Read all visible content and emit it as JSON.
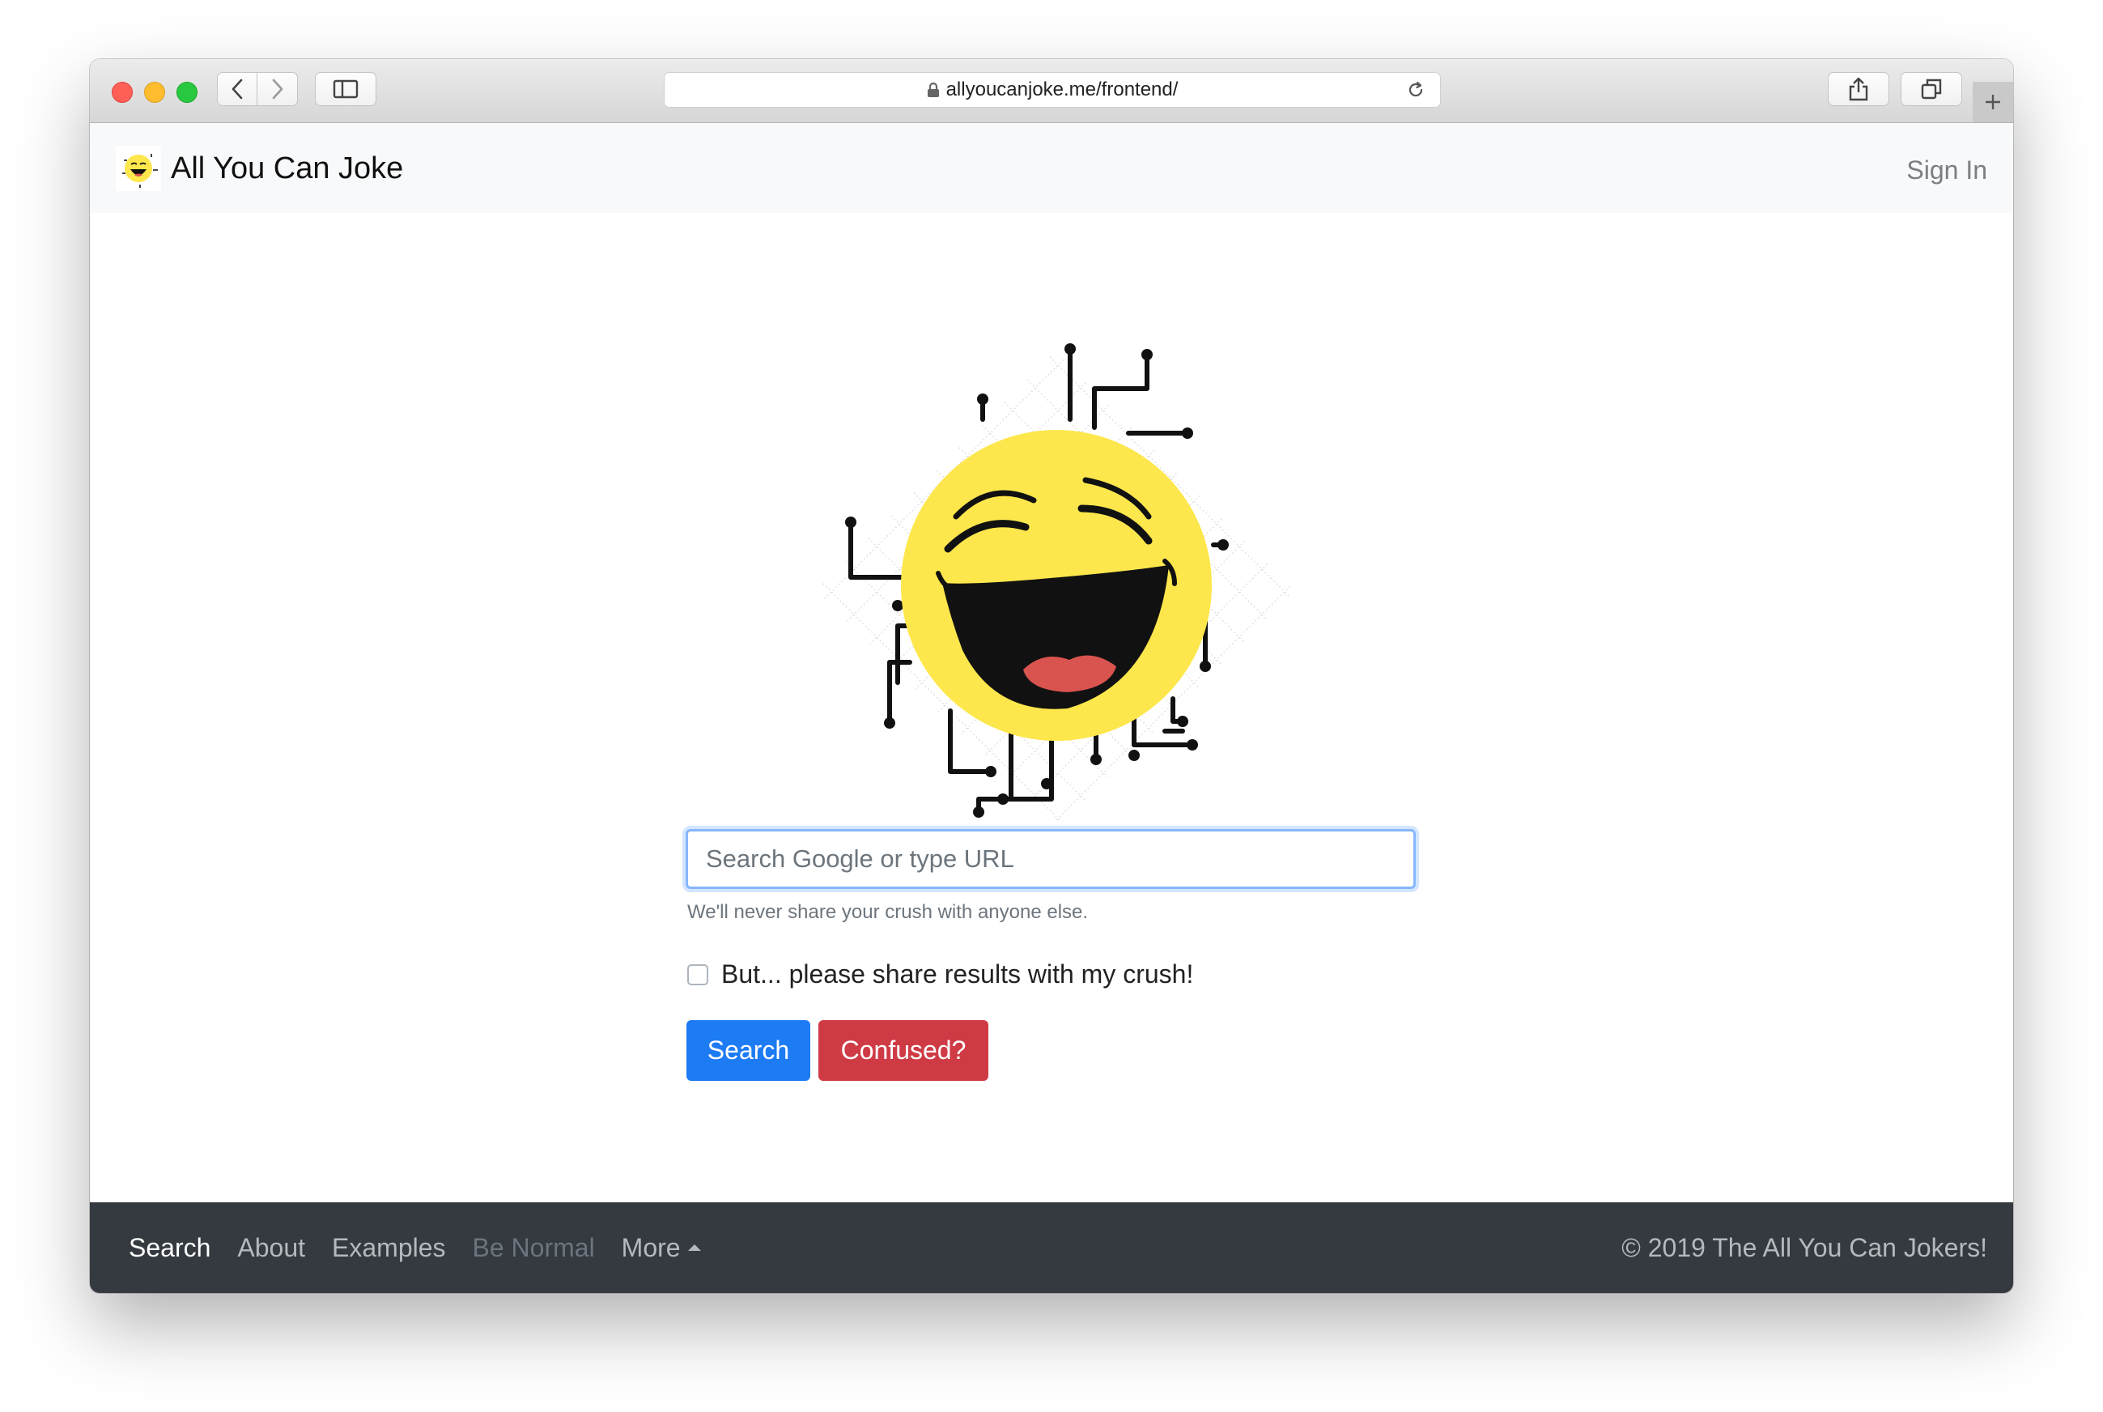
{
  "browser": {
    "url": "allyoucanjoke.me/frontend/"
  },
  "navbar": {
    "brand": "All You Can Joke",
    "sign_in": "Sign In"
  },
  "search": {
    "placeholder": "Search Google or type URL",
    "help": "We'll never share your crush with anyone else.",
    "checkbox_label": "But... please share results with my crush!",
    "checkbox_checked": false,
    "search_button": "Search",
    "confused_button": "Confused?"
  },
  "footer": {
    "links": [
      {
        "label": "Search",
        "state": "active"
      },
      {
        "label": "About",
        "state": "normal"
      },
      {
        "label": "Examples",
        "state": "normal"
      },
      {
        "label": "Be Normal",
        "state": "disabled"
      },
      {
        "label": "More",
        "state": "normal"
      }
    ],
    "copyright": "© 2019 The All You Can Jokers!"
  },
  "colors": {
    "primary": "#1d7bf3",
    "danger": "#cf3b45",
    "footer_bg": "#343a40",
    "navbar_bg": "#f8f9fa",
    "emoji_yellow": "#fde74c"
  }
}
